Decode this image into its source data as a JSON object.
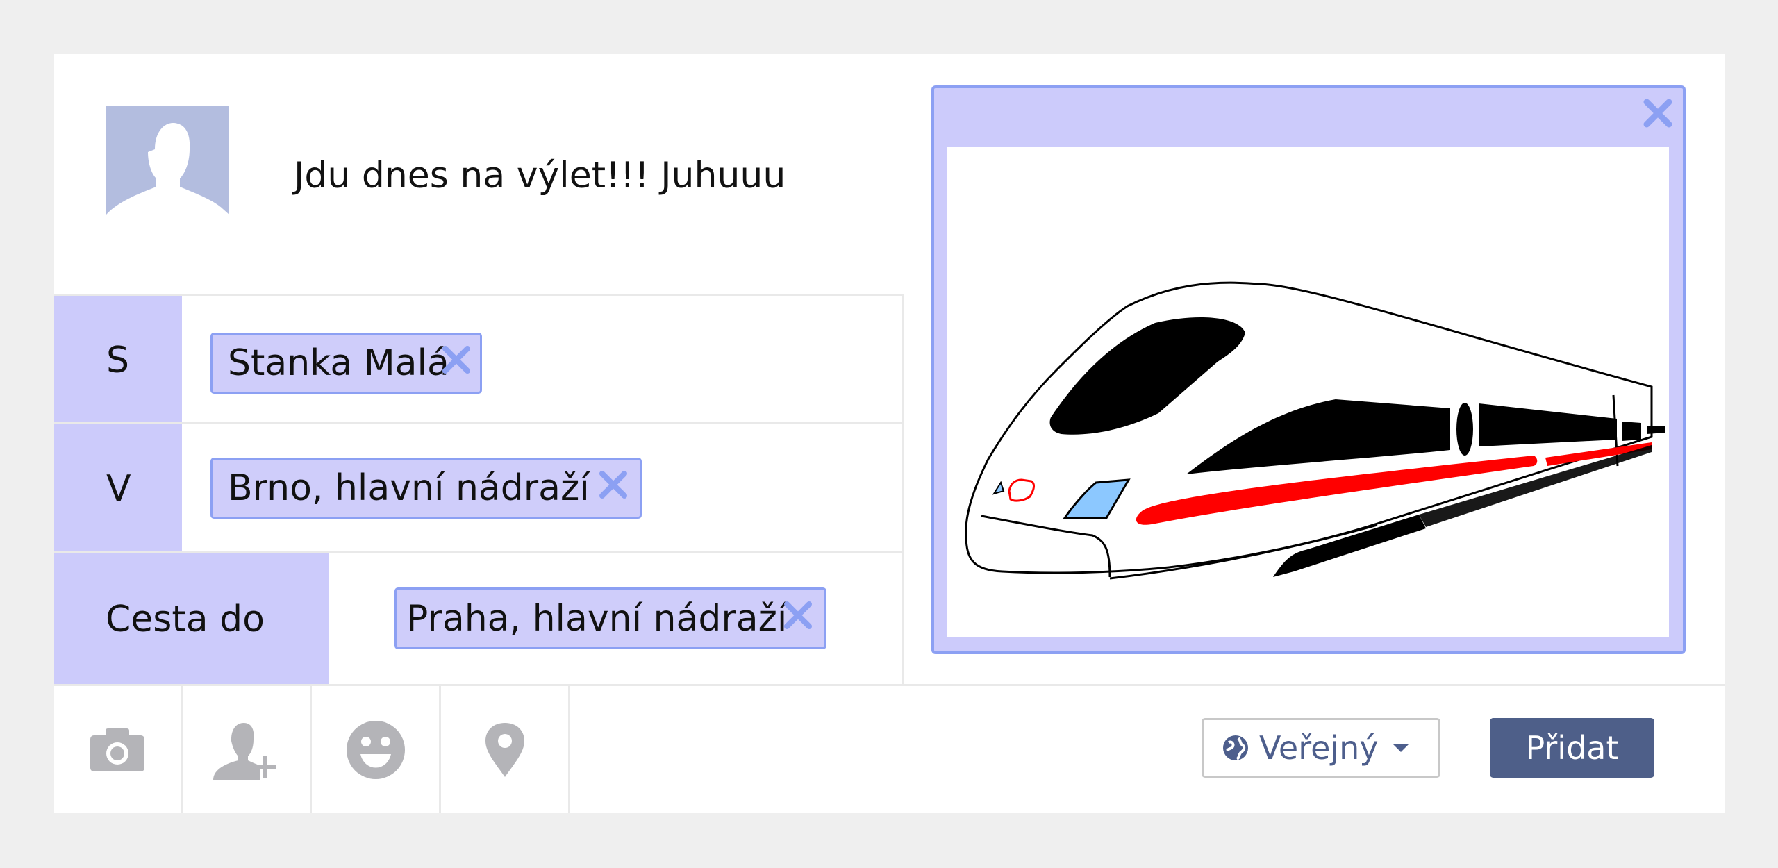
{
  "post": {
    "status_text": "Jdu dnes na výlet!!! Juhuuu"
  },
  "fields": {
    "with": {
      "label": "S",
      "chip": "Stanka Malá"
    },
    "at": {
      "label": "V",
      "chip": "Brno, hlavní nádraží"
    },
    "trip_to": {
      "label": "Cesta do",
      "chip": "Praha, hlavní nádraží"
    }
  },
  "attachment": {
    "image": "train-photo",
    "close_icon": "close-icon"
  },
  "toolbar": {
    "icons": [
      "camera-icon",
      "tag-friend-icon",
      "smiley-icon",
      "location-pin-icon"
    ],
    "privacy_label": "Veřejný",
    "submit_label": "Přidat"
  },
  "colors": {
    "page_bg": "#efefef",
    "label_bg": "#cccbfb",
    "chip_border": "#8ca0f3",
    "avatar_bg": "#b3bddf",
    "submit_bg": "#4e5f89",
    "icon_gray": "#b4b4b8",
    "accent_red": "#ff0000"
  }
}
